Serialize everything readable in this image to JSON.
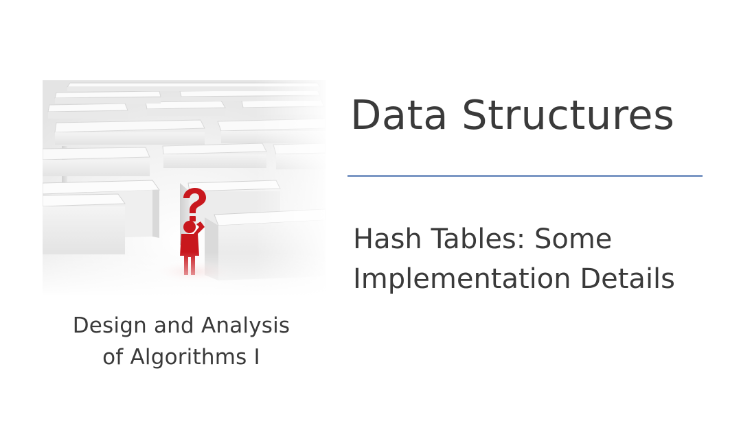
{
  "slide": {
    "title": "Data Structures",
    "subtitle_lines": [
      "Hash Tables: Some",
      "Implementation Details"
    ],
    "course_lines": [
      "Design and Analysis",
      "of Algorithms I"
    ]
  },
  "picture": {
    "icon": "maze-with-question-figure",
    "figure_color": "#c8171d",
    "divider_color": "#7b97c4"
  }
}
